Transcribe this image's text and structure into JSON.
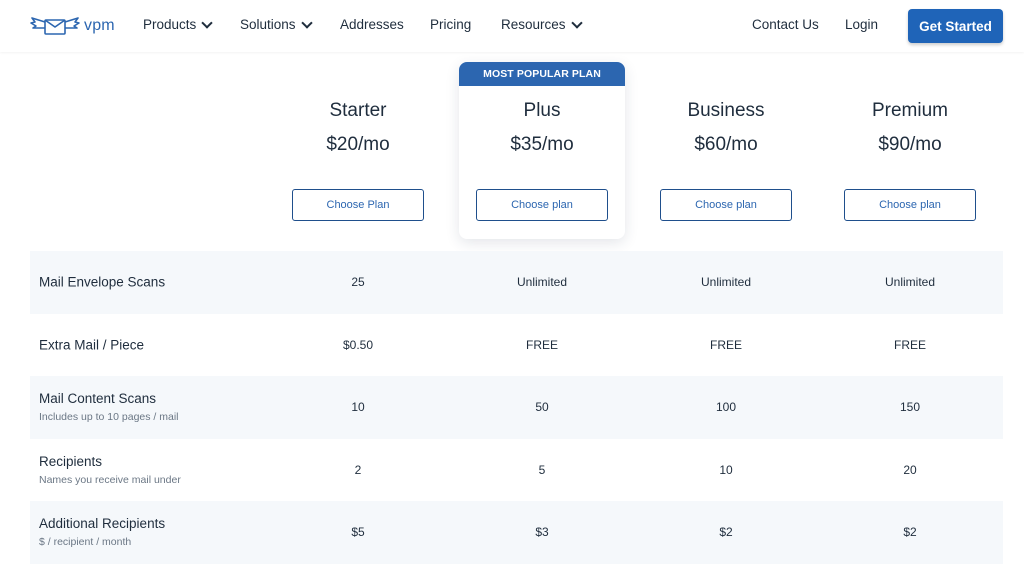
{
  "nav": {
    "logo_text": "vpm",
    "items": [
      {
        "label": "Products",
        "dropdown": true
      },
      {
        "label": "Solutions",
        "dropdown": true
      },
      {
        "label": "Addresses",
        "dropdown": false
      },
      {
        "label": "Pricing",
        "dropdown": false
      },
      {
        "label": "Resources",
        "dropdown": true
      }
    ],
    "contact": "Contact Us",
    "login": "Login",
    "cta": "Get Started"
  },
  "popular_label": "MOST POPULAR PLAN",
  "plans": [
    {
      "name": "Starter",
      "price": "$20/mo",
      "button": "Choose Plan"
    },
    {
      "name": "Plus",
      "price": "$35/mo",
      "button": "Choose plan"
    },
    {
      "name": "Business",
      "price": "$60/mo",
      "button": "Choose plan"
    },
    {
      "name": "Premium",
      "price": "$90/mo",
      "button": "Choose plan"
    }
  ],
  "features": [
    {
      "name": "Mail Envelope Scans",
      "sub": "",
      "values": [
        "25",
        "Unlimited",
        "Unlimited",
        "Unlimited"
      ]
    },
    {
      "name": "Extra Mail / Piece",
      "sub": "",
      "values": [
        "$0.50",
        "FREE",
        "FREE",
        "FREE"
      ]
    },
    {
      "name": "Mail Content Scans",
      "sub": "Includes up to 10 pages / mail",
      "values": [
        "10",
        "50",
        "100",
        "150"
      ]
    },
    {
      "name": "Recipients",
      "sub": "Names you receive mail under",
      "values": [
        "2",
        "5",
        "10",
        "20"
      ]
    },
    {
      "name": "Additional Recipients",
      "sub": "$ / recipient / month",
      "values": [
        "$5",
        "$3",
        "$2",
        "$2"
      ]
    }
  ],
  "colors": {
    "brand": "#2c66b0",
    "cta": "#1f64b8",
    "row_shade": "#f5f8fb"
  },
  "icons": {
    "logo": "winged-envelope-icon",
    "dropdown": "chevron-down-icon"
  }
}
